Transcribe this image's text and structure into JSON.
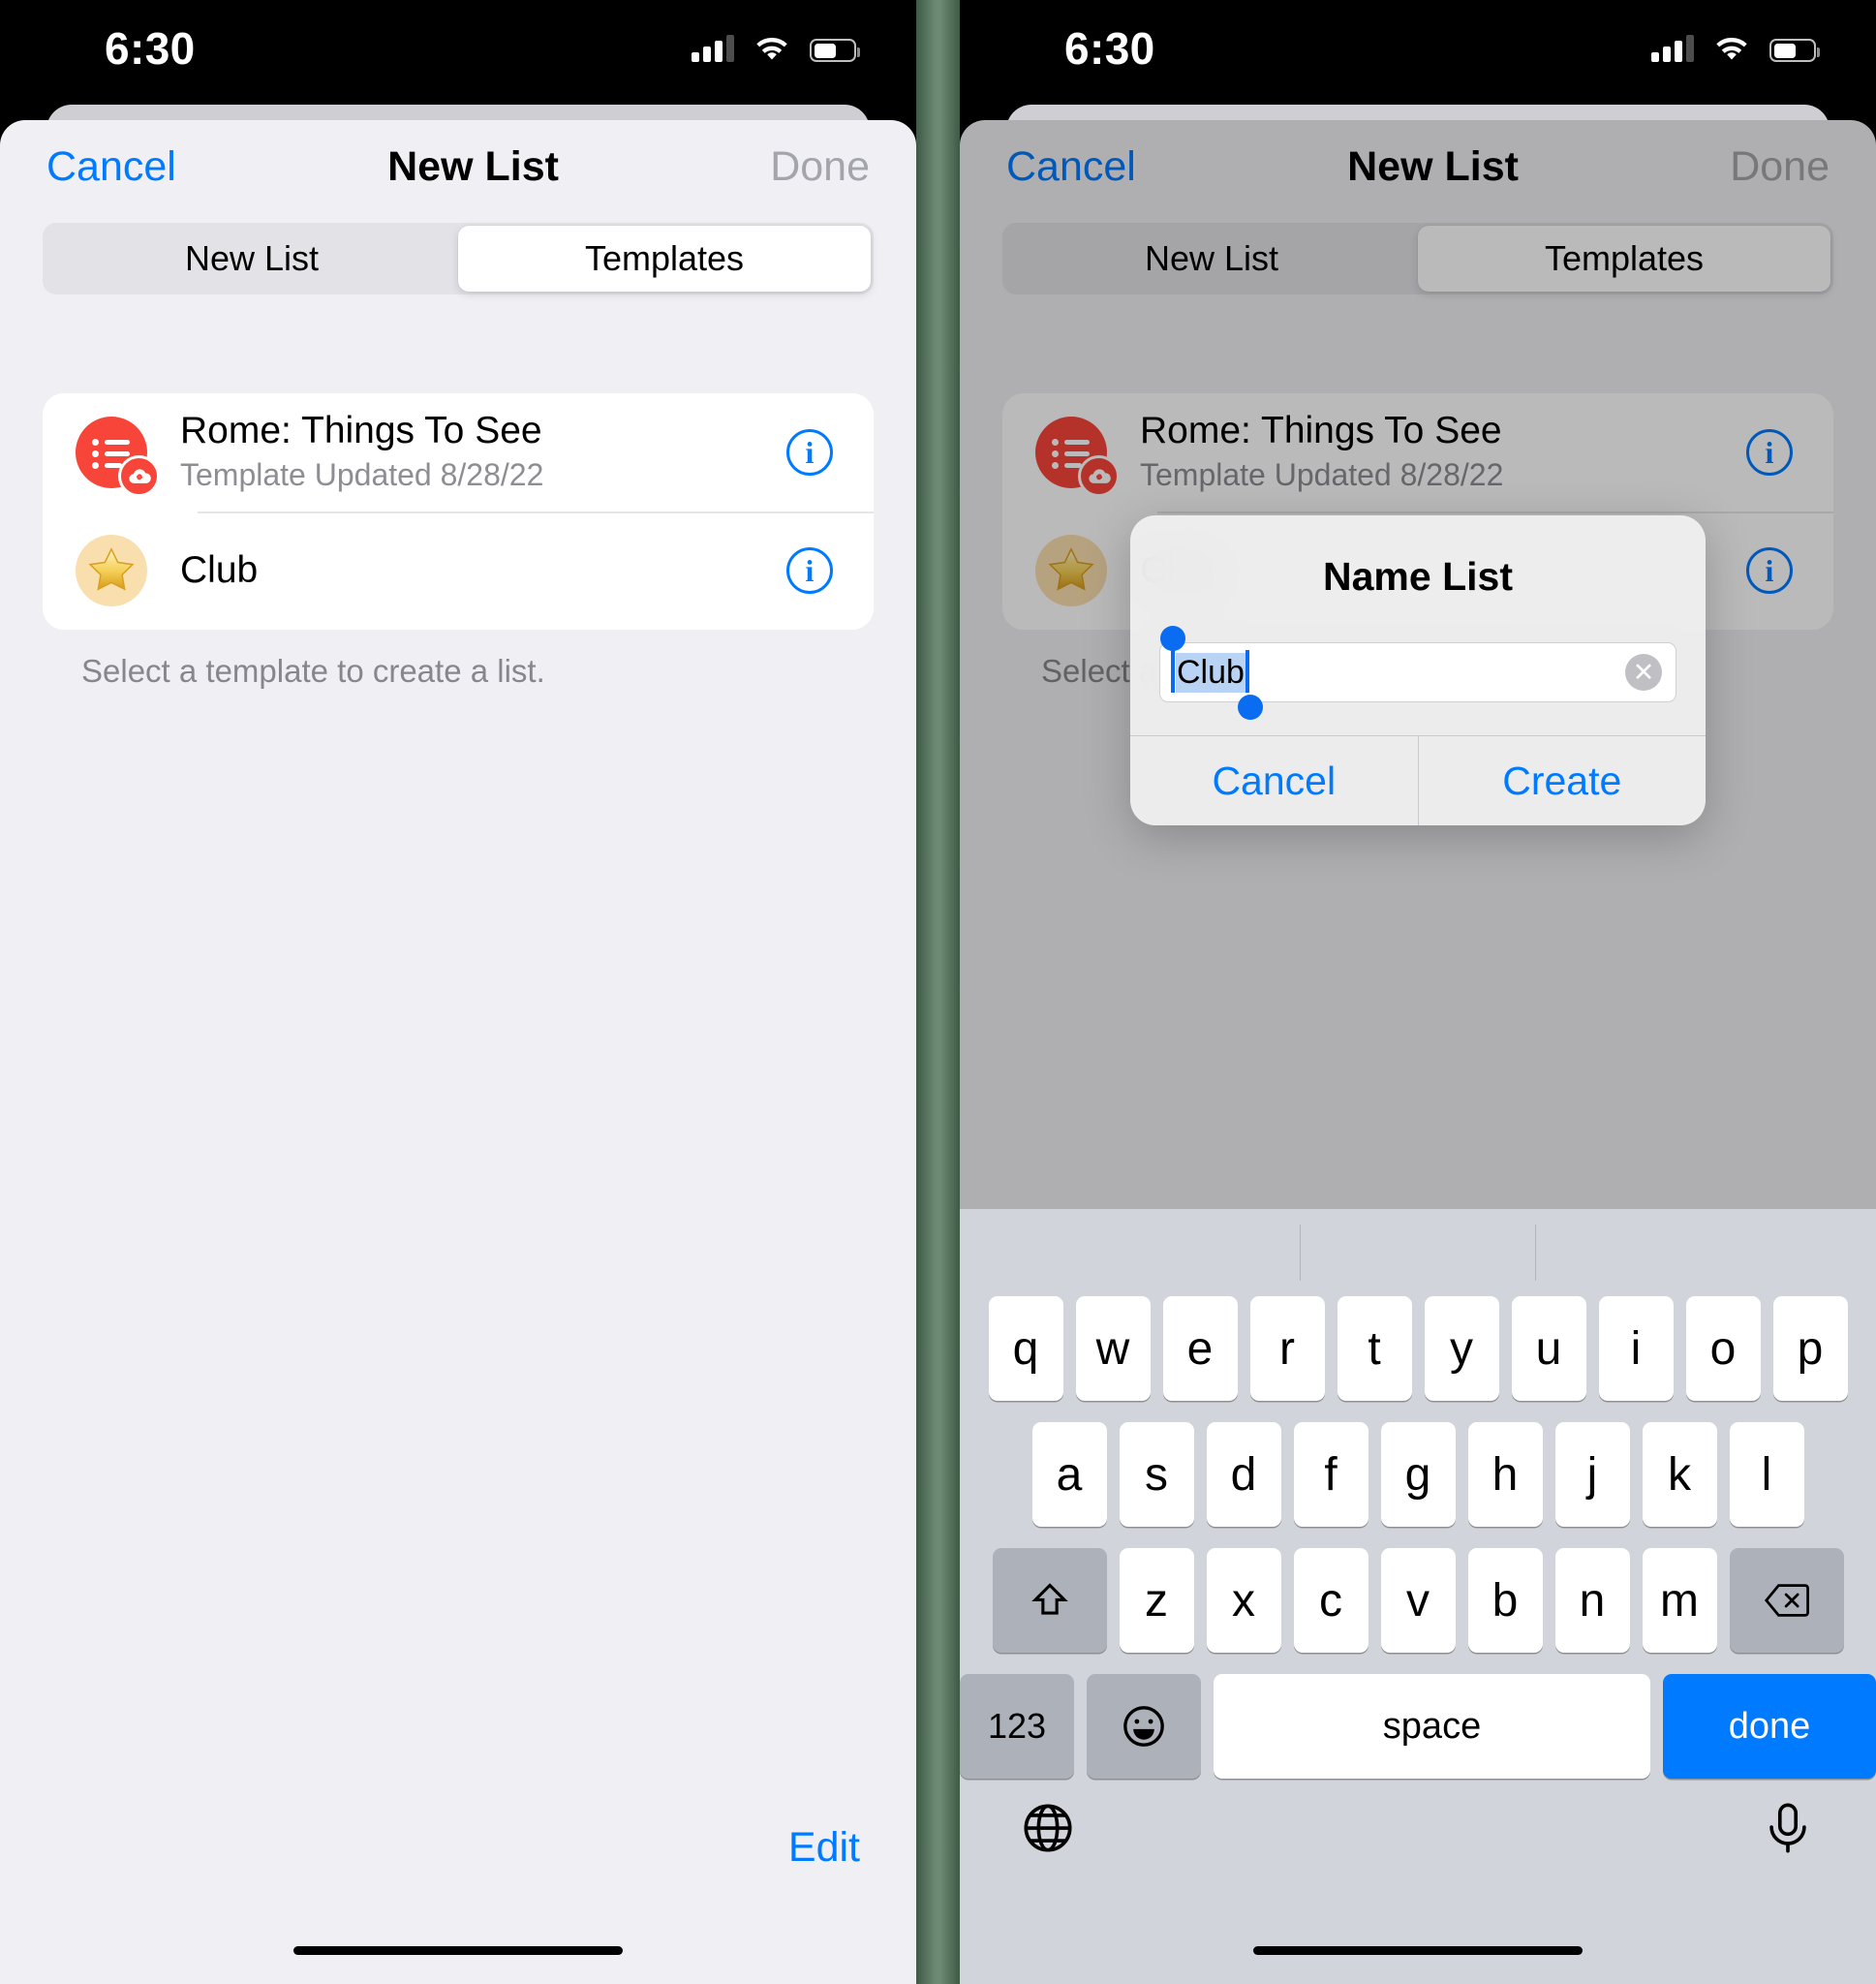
{
  "status_bar": {
    "time": "6:30",
    "signal_icon": "cellular-bars-icon",
    "wifi_icon": "wifi-icon",
    "battery_icon": "battery-icon"
  },
  "nav": {
    "cancel_label": "Cancel",
    "title": "New List",
    "done_label": "Done"
  },
  "segmented": {
    "options": [
      "New List",
      "Templates"
    ],
    "selected": "Templates"
  },
  "templates": [
    {
      "title": "Rome: Things To See",
      "subtitle": "Template Updated 8/28/22",
      "icon": "list-bullets-icon",
      "badge_icon": "cloud-link-icon",
      "info_icon": "info-circle-icon"
    },
    {
      "title": "Club",
      "subtitle": "",
      "icon": "star-icon",
      "badge_icon": "",
      "info_icon": "info-circle-icon"
    }
  ],
  "caption": "Select a template to create a list.",
  "edit_label": "Edit",
  "alert": {
    "title": "Name List",
    "field_value": "Club",
    "clear_icon": "clear-circle-icon",
    "cancel_label": "Cancel",
    "create_label": "Create"
  },
  "keyboard": {
    "row1": [
      "q",
      "w",
      "e",
      "r",
      "t",
      "y",
      "u",
      "i",
      "o",
      "p"
    ],
    "row2": [
      "a",
      "s",
      "d",
      "f",
      "g",
      "h",
      "j",
      "k",
      "l"
    ],
    "row3": [
      "z",
      "x",
      "c",
      "v",
      "b",
      "n",
      "m"
    ],
    "shift_icon": "shift-arrow-icon",
    "backspace_icon": "backspace-icon",
    "numbers_label": "123",
    "emoji_icon": "emoji-smiley-icon",
    "space_label": "space",
    "done_label": "done",
    "globe_icon": "globe-icon",
    "mic_icon": "microphone-icon"
  }
}
